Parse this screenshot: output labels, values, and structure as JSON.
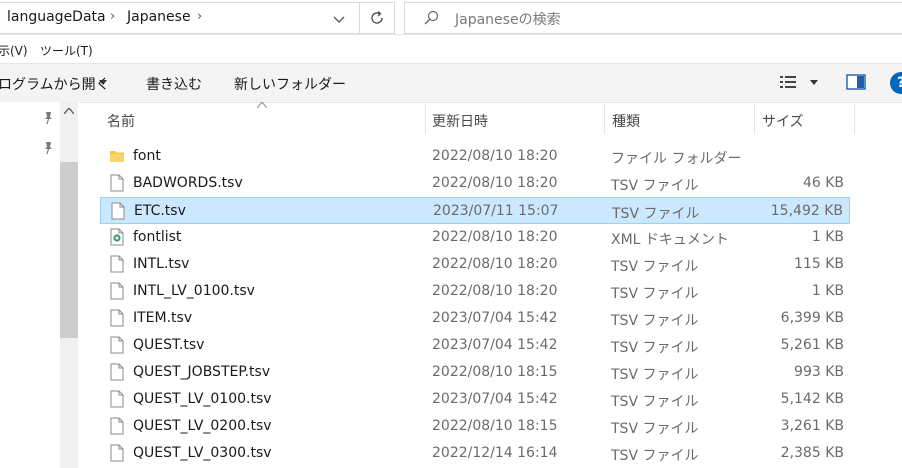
{
  "address": {
    "crumbs": [
      "languageData",
      "Japanese"
    ]
  },
  "search": {
    "placeholder": "Japaneseの検索"
  },
  "menu": {
    "items": [
      "示(V)",
      "ツール(T)"
    ]
  },
  "command_bar": {
    "open_with": "ログラムから開く",
    "write": "書き込む",
    "new_folder": "新しいフォルダー"
  },
  "columns": {
    "name": "名前",
    "date": "更新日時",
    "type": "種類",
    "size": "サイズ"
  },
  "files": [
    {
      "name": "font",
      "date": "2022/08/10 18:20",
      "type": "ファイル フォルダー",
      "size": "",
      "icon": "folder-icon"
    },
    {
      "name": "BADWORDS.tsv",
      "date": "2022/08/10 18:20",
      "type": "TSV ファイル",
      "size": "46 KB",
      "icon": "file-icon"
    },
    {
      "name": "ETC.tsv",
      "date": "2023/07/11 15:07",
      "type": "TSV ファイル",
      "size": "15,492 KB",
      "icon": "file-icon",
      "selected": true
    },
    {
      "name": "fontlist",
      "date": "2022/08/10 18:20",
      "type": "XML ドキュメント",
      "size": "1 KB",
      "icon": "xml-file-icon"
    },
    {
      "name": "INTL.tsv",
      "date": "2022/08/10 18:20",
      "type": "TSV ファイル",
      "size": "115 KB",
      "icon": "file-icon"
    },
    {
      "name": "INTL_LV_0100.tsv",
      "date": "2022/08/10 18:20",
      "type": "TSV ファイル",
      "size": "1 KB",
      "icon": "file-icon"
    },
    {
      "name": "ITEM.tsv",
      "date": "2023/07/04 15:42",
      "type": "TSV ファイル",
      "size": "6,399 KB",
      "icon": "file-icon"
    },
    {
      "name": "QUEST.tsv",
      "date": "2023/07/04 15:42",
      "type": "TSV ファイル",
      "size": "5,261 KB",
      "icon": "file-icon"
    },
    {
      "name": "QUEST_JOBSTEP.tsv",
      "date": "2022/08/10 18:15",
      "type": "TSV ファイル",
      "size": "993 KB",
      "icon": "file-icon"
    },
    {
      "name": "QUEST_LV_0100.tsv",
      "date": "2023/07/04 15:42",
      "type": "TSV ファイル",
      "size": "5,142 KB",
      "icon": "file-icon"
    },
    {
      "name": "QUEST_LV_0200.tsv",
      "date": "2022/08/10 18:15",
      "type": "TSV ファイル",
      "size": "3,261 KB",
      "icon": "file-icon"
    },
    {
      "name": "QUEST_LV_0300.tsv",
      "date": "2022/12/14 16:14",
      "type": "TSV ファイル",
      "size": "2,385 KB",
      "icon": "file-icon"
    }
  ],
  "colors": {
    "selection_bg": "#cce8ff",
    "selection_border": "#99d1ff",
    "help_blue": "#0067c0",
    "folder_yellow": "#f4c542"
  }
}
